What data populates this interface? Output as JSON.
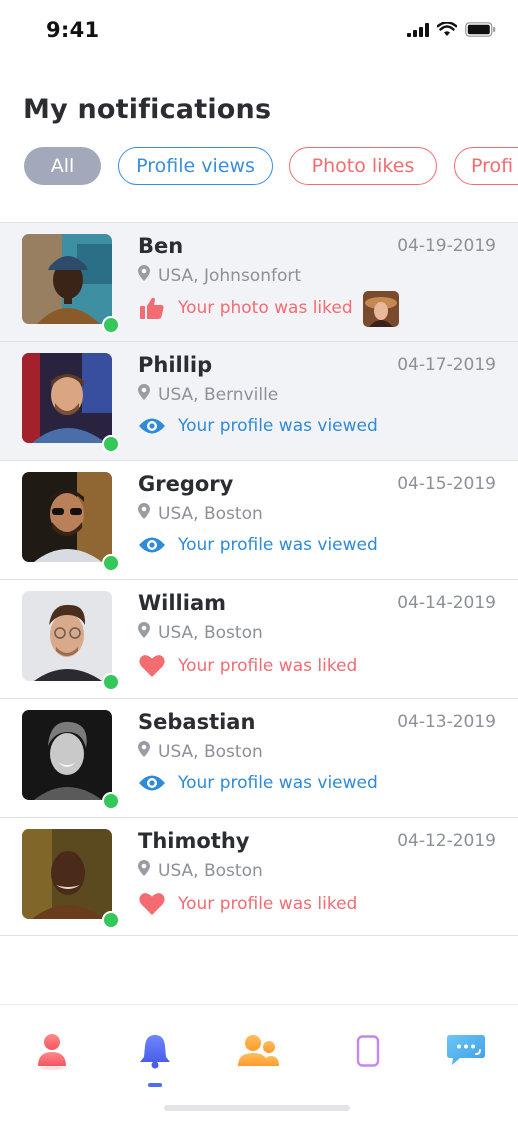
{
  "status_bar": {
    "time": "9:41"
  },
  "title": "My notifications",
  "filters": [
    {
      "label": "All"
    },
    {
      "label": "Profile views"
    },
    {
      "label": "Photo likes"
    },
    {
      "label": "Profi"
    }
  ],
  "notifications": [
    {
      "name": "Ben",
      "date": "04-19-2019",
      "location": "USA, Johnsonfort",
      "event": "Your photo was liked",
      "type": "photo-like",
      "icon": "thumbs-up-icon",
      "online": true,
      "unread": true
    },
    {
      "name": "Phillip",
      "date": "04-17-2019",
      "location": "USA, Bernville",
      "event": "Your profile was viewed",
      "type": "view",
      "icon": "eye-icon",
      "online": true,
      "unread": true
    },
    {
      "name": "Gregory",
      "date": "04-15-2019",
      "location": "USA, Boston",
      "event": "Your profile was viewed",
      "type": "view",
      "icon": "eye-icon",
      "online": true,
      "unread": false
    },
    {
      "name": "William",
      "date": "04-14-2019",
      "location": "USA, Boston",
      "event": "Your profile was liked",
      "type": "like",
      "icon": "heart-icon",
      "online": true,
      "unread": false
    },
    {
      "name": "Sebastian",
      "date": "04-13-2019",
      "location": "USA, Boston",
      "event": "Your profile was viewed",
      "type": "view",
      "icon": "eye-icon",
      "online": true,
      "unread": false
    },
    {
      "name": "Thimothy",
      "date": "04-12-2019",
      "location": "USA, Boston",
      "event": "Your profile was liked",
      "type": "like",
      "icon": "heart-icon",
      "online": true,
      "unread": false
    }
  ],
  "tabs": [
    {
      "icon": "profile-icon",
      "active": false
    },
    {
      "icon": "bell-icon",
      "active": true
    },
    {
      "icon": "friends-icon",
      "active": false
    },
    {
      "icon": "phone-icon",
      "active": false
    },
    {
      "icon": "chat-icon",
      "active": false
    }
  ],
  "colors": {
    "like": "#f26c72",
    "view": "#2f8ad8",
    "online": "#34c759",
    "chip_active_bg": "#a4a8bb",
    "tab_active": "#4f6cf2"
  }
}
